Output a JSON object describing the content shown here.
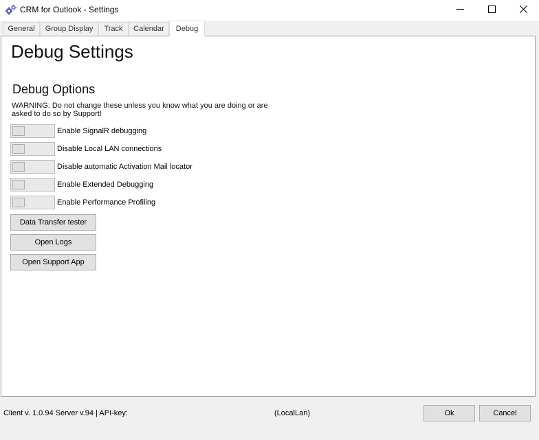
{
  "window": {
    "title": "CRM for Outlook - Settings",
    "icon": "app-gears-icon",
    "controls": [
      "minimize-icon",
      "maximize-icon",
      "close-icon"
    ]
  },
  "tabs": [
    {
      "label": "General",
      "active": false
    },
    {
      "label": "Group Display",
      "active": false
    },
    {
      "label": "Track",
      "active": false
    },
    {
      "label": "Calendar",
      "active": false
    },
    {
      "label": "Debug",
      "active": true
    }
  ],
  "debug": {
    "page_title": "Debug Settings",
    "section_title": "Debug Options",
    "warning": "WARNING: Do not change these unless you know what you are doing or are asked to do so by Support!",
    "options": [
      {
        "label": "Enable SignalR debugging",
        "checked": false
      },
      {
        "label": "Disable Local LAN connections",
        "checked": false
      },
      {
        "label": "Disable automatic Activation Mail locator",
        "checked": false
      },
      {
        "label": "Enable Extended Debugging",
        "checked": false
      },
      {
        "label": "Enable Performance Profiling",
        "checked": false
      }
    ],
    "buttons": {
      "data_transfer_tester": "Data Transfer tester",
      "open_logs": "Open Logs",
      "open_support_app": "Open Support App"
    }
  },
  "footer": {
    "status": "Client v. 1.0.94 Server v.94 | API-key:",
    "connection_mode": "(LocalLan)",
    "ok_label": "Ok",
    "cancel_label": "Cancel"
  },
  "colors": {
    "window_background": "#f0f0f0",
    "panel_background": "#ffffff",
    "button_face": "#e1e1e1",
    "button_border": "#adadad"
  }
}
